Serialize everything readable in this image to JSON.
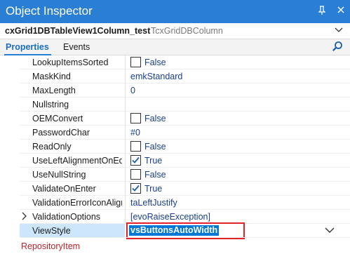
{
  "window": {
    "title": "Object Inspector"
  },
  "object_selector": {
    "name": "cxGrid1DBTableView1Column_test",
    "class": "TcxGridDBColumn"
  },
  "tabs": {
    "properties": "Properties",
    "events": "Events"
  },
  "properties": [
    {
      "name": "LookupItemsSorted",
      "type": "checkbox",
      "checked": false,
      "value": "False"
    },
    {
      "name": "MaskKind",
      "type": "text",
      "value": "emkStandard"
    },
    {
      "name": "MaxLength",
      "type": "text",
      "value": "0"
    },
    {
      "name": "Nullstring",
      "type": "text",
      "value": ""
    },
    {
      "name": "OEMConvert",
      "type": "checkbox",
      "checked": false,
      "value": "False"
    },
    {
      "name": "PasswordChar",
      "type": "text",
      "value": "#0"
    },
    {
      "name": "ReadOnly",
      "type": "checkbox",
      "checked": false,
      "value": "False"
    },
    {
      "name": "UseLeftAlignmentOnEdit",
      "type": "checkbox",
      "checked": true,
      "value": "True"
    },
    {
      "name": "UseNullString",
      "type": "checkbox",
      "checked": false,
      "value": "False"
    },
    {
      "name": "ValidateOnEnter",
      "type": "checkbox",
      "checked": true,
      "value": "True"
    },
    {
      "name": "ValidationErrorIconAlignment",
      "type": "text",
      "value": "taLeftJustify"
    },
    {
      "name": "ValidationOptions",
      "type": "set",
      "value": "[evoRaiseException]"
    },
    {
      "name": "ViewStyle",
      "type": "dropdown",
      "value": "vsButtonsAutoWidth",
      "selected": true
    },
    {
      "name": "RepositoryItem",
      "type": "text",
      "value": ""
    }
  ],
  "colors": {
    "title_bar": "#2a7fd4",
    "selection": "#0078d7",
    "highlight_box": "#e4222b",
    "value_text": "#1a3f8f",
    "reference_property": "#b8252b"
  }
}
